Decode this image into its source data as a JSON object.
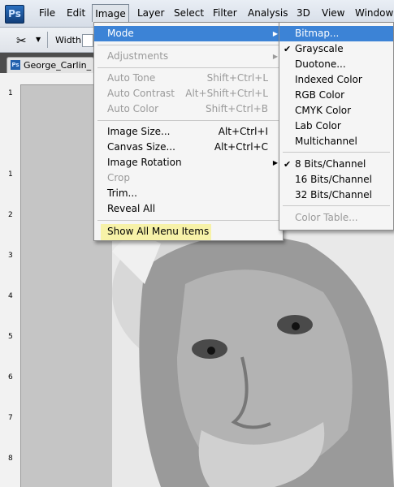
{
  "app": {
    "logo": "Ps"
  },
  "menubar": {
    "items": [
      "File",
      "Edit",
      "Image",
      "Layer",
      "Select",
      "Filter",
      "Analysis",
      "3D",
      "View",
      "Window"
    ]
  },
  "options": {
    "width_label": "Width:"
  },
  "document": {
    "tab_label": "George_Carlin_"
  },
  "ruler": {
    "numbers": [
      "1",
      "1",
      "2",
      "3",
      "4",
      "5",
      "6",
      "7",
      "8"
    ]
  },
  "image_menu": {
    "mode": "Mode",
    "adjustments": "Adjustments",
    "auto_tone": {
      "label": "Auto Tone",
      "shortcut": "Shift+Ctrl+L"
    },
    "auto_contrast": {
      "label": "Auto Contrast",
      "shortcut": "Alt+Shift+Ctrl+L"
    },
    "auto_color": {
      "label": "Auto Color",
      "shortcut": "Shift+Ctrl+B"
    },
    "image_size": {
      "label": "Image Size...",
      "shortcut": "Alt+Ctrl+I"
    },
    "canvas_size": {
      "label": "Canvas Size...",
      "shortcut": "Alt+Ctrl+C"
    },
    "image_rotation": "Image Rotation",
    "crop": "Crop",
    "trim": "Trim...",
    "reveal_all": "Reveal All",
    "show_all": "Show All Menu Items"
  },
  "mode_menu": {
    "bitmap": "Bitmap...",
    "grayscale": "Grayscale",
    "duotone": "Duotone...",
    "indexed_color": "Indexed Color",
    "rgb_color": "RGB Color",
    "cmyk_color": "CMYK Color",
    "lab_color": "Lab Color",
    "multichannel": "Multichannel",
    "bits8": "8 Bits/Channel",
    "bits16": "16 Bits/Channel",
    "bits32": "32 Bits/Channel",
    "color_table": "Color Table..."
  },
  "colors": {
    "highlight": "#3c83d6",
    "tip_highlight": "#f7f2a8"
  }
}
